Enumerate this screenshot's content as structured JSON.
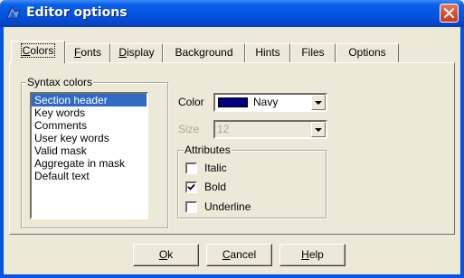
{
  "window": {
    "title": "Editor options",
    "icon": "editor-app-icon",
    "close_icon": "close-icon"
  },
  "tabs": [
    {
      "label_ul": "C",
      "label_rest": "olors",
      "active": true
    },
    {
      "label_ul": "F",
      "label_rest": "onts"
    },
    {
      "label_ul": "D",
      "label_rest": "isplay"
    },
    {
      "label_ul": "",
      "label_rest": "Background"
    },
    {
      "label_ul": "",
      "label_rest": "Hints"
    },
    {
      "label_ul": "",
      "label_rest": "Files"
    },
    {
      "label_ul": "",
      "label_rest": "Options"
    }
  ],
  "syntax_colors": {
    "legend": "Syntax colors",
    "items": [
      "Section header",
      "Key words",
      "Comments",
      "User key words",
      "Valid mask",
      "Aggregate in mask",
      "Default text"
    ],
    "selected": "Section header"
  },
  "color": {
    "label": "Color",
    "value": "Navy",
    "swatch_color": "#000080"
  },
  "size": {
    "label": "Size",
    "value": "12",
    "disabled": true
  },
  "attributes": {
    "legend": "Attributes",
    "italic": {
      "label": "Italic",
      "checked": false
    },
    "bold": {
      "label": "Bold",
      "checked": true
    },
    "underline": {
      "label": "Underline",
      "checked": false
    }
  },
  "buttons": {
    "ok": {
      "ul": "O",
      "rest": "k"
    },
    "cancel": {
      "ul": "C",
      "rest": "ancel"
    },
    "help": {
      "ul": "H",
      "rest": "elp"
    }
  },
  "colors": {
    "titlebar": "#0554E2",
    "face": "#ECE9D8",
    "selection": "#316AC5",
    "close": "#D54E2D"
  }
}
